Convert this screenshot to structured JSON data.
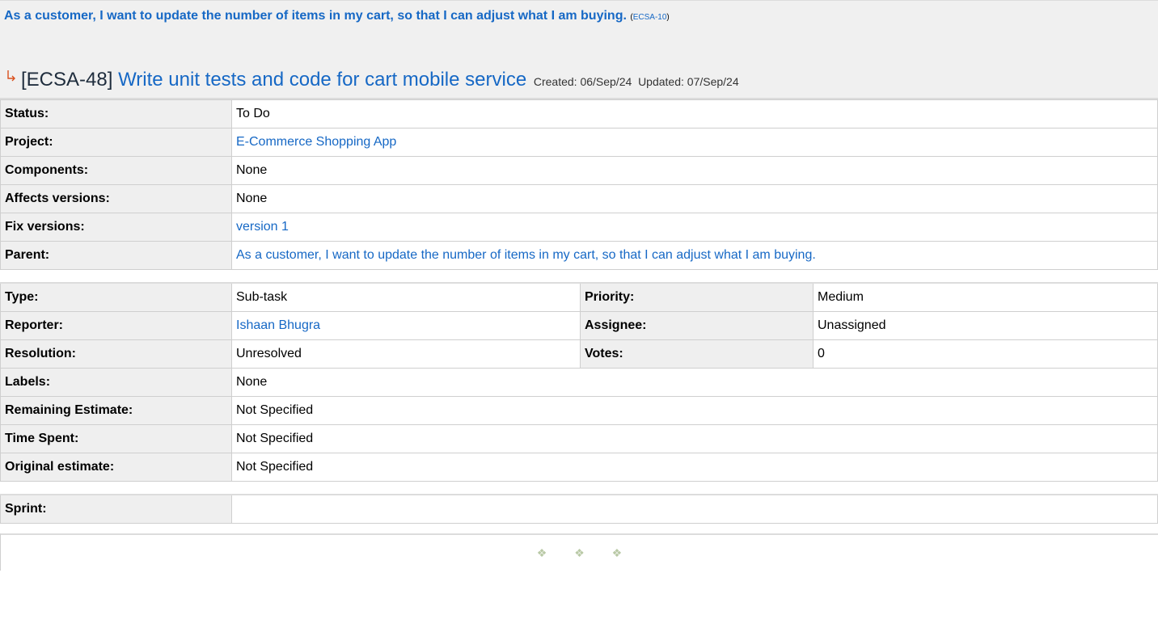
{
  "parent": {
    "summary": "As a customer, I want to update the number of items in my cart, so that I can adjust what I am buying.",
    "key": "ECSA-10",
    "paren_open": "(",
    "paren_close": ")"
  },
  "issue": {
    "key": "[ECSA-48]",
    "summary": "Write unit tests and code for cart mobile service",
    "created_label": "Created:",
    "created": "06/Sep/24",
    "updated_label": "Updated:",
    "updated": "07/Sep/24",
    "icon": "subtask-arrow-icon"
  },
  "fields1": [
    {
      "label": "Status:",
      "value": "To Do",
      "link": false
    },
    {
      "label": "Project:",
      "value": "E-Commerce Shopping App",
      "link": true
    },
    {
      "label": "Components:",
      "value": "None",
      "link": false
    },
    {
      "label": "Affects versions:",
      "value": "None",
      "link": false
    },
    {
      "label": "Fix versions:",
      "value": "version 1",
      "link": true
    },
    {
      "label": "Parent:",
      "value": "As a customer, I want to update the number of items in my cart, so that I can adjust what I am buying.",
      "link": true
    }
  ],
  "fields2": {
    "type_label": "Type:",
    "type": "Sub-task",
    "priority_label": "Priority:",
    "priority": "Medium",
    "reporter_label": "Reporter:",
    "reporter": "Ishaan Bhugra",
    "assignee_label": "Assignee:",
    "assignee": "Unassigned",
    "resolution_label": "Resolution:",
    "resolution": "Unresolved",
    "votes_label": "Votes:",
    "votes": "0",
    "labels_label": "Labels:",
    "labels": "None",
    "remaining_label": "Remaining Estimate:",
    "remaining": "Not Specified",
    "spent_label": "Time Spent:",
    "spent": "Not Specified",
    "original_label": "Original estimate:",
    "original": "Not Specified"
  },
  "sprint": {
    "label": "Sprint:",
    "value": ""
  },
  "divider": {
    "glyph": "❖"
  },
  "colors": {
    "link": "#1668c5",
    "label_bg": "#efefef",
    "header_bg": "#f0f0f0"
  }
}
